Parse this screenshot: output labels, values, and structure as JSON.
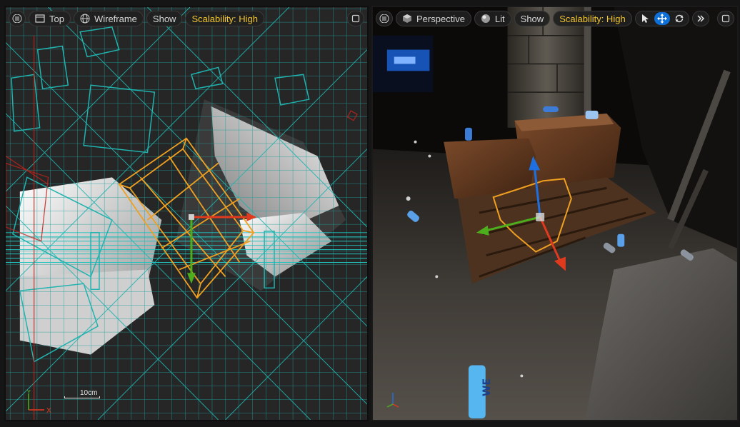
{
  "left_viewport": {
    "menu_icon": "hamburger-icon",
    "view_mode_label": "Top",
    "view_mode_icon": "viewport-square-icon",
    "render_mode_label": "Wireframe",
    "render_mode_icon": "wireframe-sphere-icon",
    "show_label": "Show",
    "scalability_label": "Scalability: High",
    "maximize_icon": "maximize-icon",
    "scale_label": "10cm",
    "axis_x_label": "X",
    "axis_y_label": "Y"
  },
  "right_viewport": {
    "menu_icon": "hamburger-icon",
    "view_mode_label": "Perspective",
    "view_mode_icon": "cube-icon",
    "render_mode_label": "Lit",
    "render_mode_icon": "lit-sphere-icon",
    "show_label": "Show",
    "scalability_label": "Scalability: High",
    "tools": [
      {
        "name": "select-tool",
        "icon": "cursor-icon",
        "active": false
      },
      {
        "name": "translate-tool",
        "icon": "move-arrows-icon",
        "active": true
      },
      {
        "name": "rotate-tool",
        "icon": "rotate-icon",
        "active": false
      }
    ],
    "overflow_icon": "chevron-double-right-icon",
    "maximize_icon": "maximize-icon",
    "can_text": "WE"
  },
  "colors": {
    "wireframe": "#1fa8a5",
    "selection": "#f0a020",
    "gizmo_x": "#e03a1e",
    "gizmo_y": "#4cae1c",
    "gizmo_z": "#1e6fe0",
    "scalability_text": "#f2c630",
    "active_tool": "#0e6fd6"
  }
}
